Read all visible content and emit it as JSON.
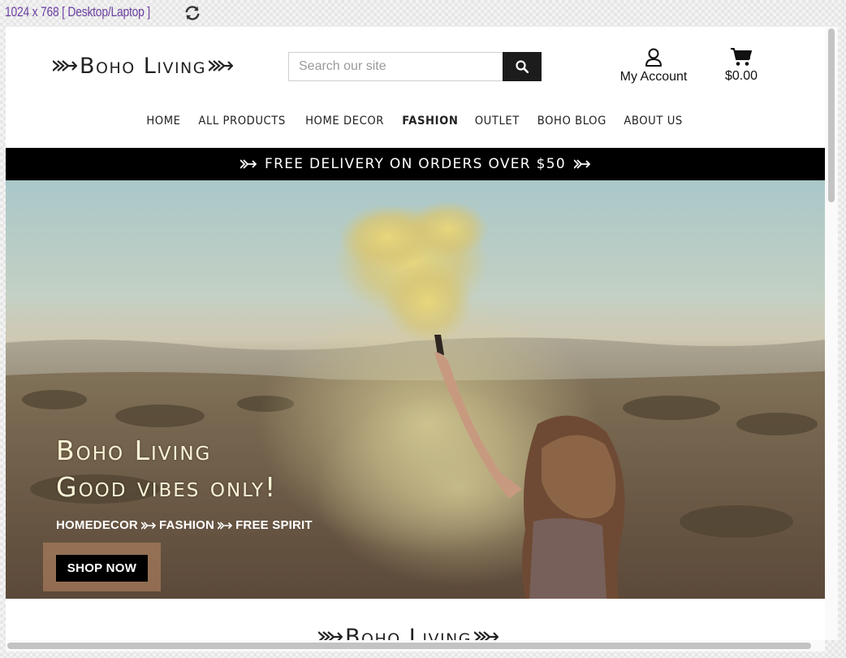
{
  "device_toolbar": {
    "size_label": "1024 x 768 [ Desktop/Laptop ]",
    "rotate_icon": "rotate-icon"
  },
  "header": {
    "logo_text": "Boho Living",
    "search": {
      "placeholder": "Search our site",
      "value": ""
    },
    "account_label": "My Account",
    "cart_total": "$0.00"
  },
  "nav": {
    "items": [
      "HOME",
      "ALL PRODUCTS",
      "HOME DECOR",
      "FASHION",
      "OUTLET",
      "BOHO BLOG",
      "ABOUT US"
    ],
    "active": "FASHION"
  },
  "promo": {
    "text": "FREE DELIVERY ON ORDERS OVER $50"
  },
  "hero": {
    "title_line1": "Boho Living",
    "title_line2": "Good vibes only!",
    "subtitle_parts": [
      "HOMEDECOR",
      "FASHION",
      "FREE SPIRIT"
    ],
    "cta_label": "SHOP NOW"
  },
  "footer_logo_text": "Boho Living",
  "colors": {
    "accent_purple": "#6a3fa0",
    "promo_bg": "#000000",
    "hero_text": "#fbf3d6"
  }
}
